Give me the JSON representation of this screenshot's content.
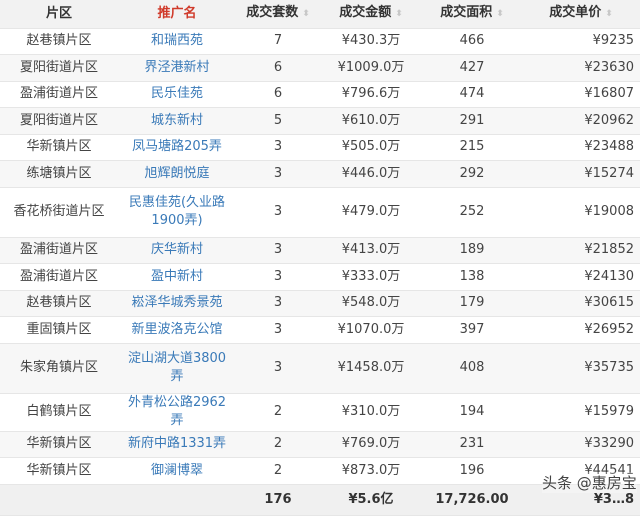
{
  "headers": [
    "片区",
    "推广名",
    "成交套数",
    "成交金额",
    "成交面积",
    "成交单价"
  ],
  "sort_icon": "sort-icon",
  "rows": [
    [
      "赵巷镇片区",
      "和瑞西苑",
      "7",
      "¥430.3万",
      "466",
      "¥9235"
    ],
    [
      "夏阳街道片区",
      "界泾港新村",
      "6",
      "¥1009.0万",
      "427",
      "¥23630"
    ],
    [
      "盈浦街道片区",
      "民乐佳苑",
      "6",
      "¥796.6万",
      "474",
      "¥16807"
    ],
    [
      "夏阳街道片区",
      "城东新村",
      "5",
      "¥610.0万",
      "291",
      "¥20962"
    ],
    [
      "华新镇片区",
      "凤马塘路205弄",
      "3",
      "¥505.0万",
      "215",
      "¥23488"
    ],
    [
      "练塘镇片区",
      "旭辉朗悦庭",
      "3",
      "¥446.0万",
      "292",
      "¥15274"
    ],
    [
      "香花桥街道片区",
      "民惠佳苑(久业路1900弄)",
      "3",
      "¥479.0万",
      "252",
      "¥19008"
    ],
    [
      "盈浦街道片区",
      "庆华新村",
      "3",
      "¥413.0万",
      "189",
      "¥21852"
    ],
    [
      "盈浦街道片区",
      "盈中新村",
      "3",
      "¥333.0万",
      "138",
      "¥24130"
    ],
    [
      "赵巷镇片区",
      "崧泽华城秀景苑",
      "3",
      "¥548.0万",
      "179",
      "¥30615"
    ],
    [
      "重固镇片区",
      "新里波洛克公馆",
      "3",
      "¥1070.0万",
      "397",
      "¥26952"
    ],
    [
      "朱家角镇片区",
      "淀山湖大道3800弄",
      "3",
      "¥1458.0万",
      "408",
      "¥35735"
    ],
    [
      "白鹤镇片区",
      "外青松公路2962弄",
      "2",
      "¥310.0万",
      "194",
      "¥15979"
    ],
    [
      "华新镇片区",
      "新府中路1331弄",
      "2",
      "¥769.0万",
      "231",
      "¥33290"
    ],
    [
      "华新镇片区",
      "御澜博翠",
      "2",
      "¥873.0万",
      "196",
      "¥44541"
    ]
  ],
  "totals": {
    "count": "176",
    "amount": "¥5.6亿",
    "area": "17,726.00",
    "price": "¥3…8"
  },
  "watermark": "头条 @惠房宝"
}
